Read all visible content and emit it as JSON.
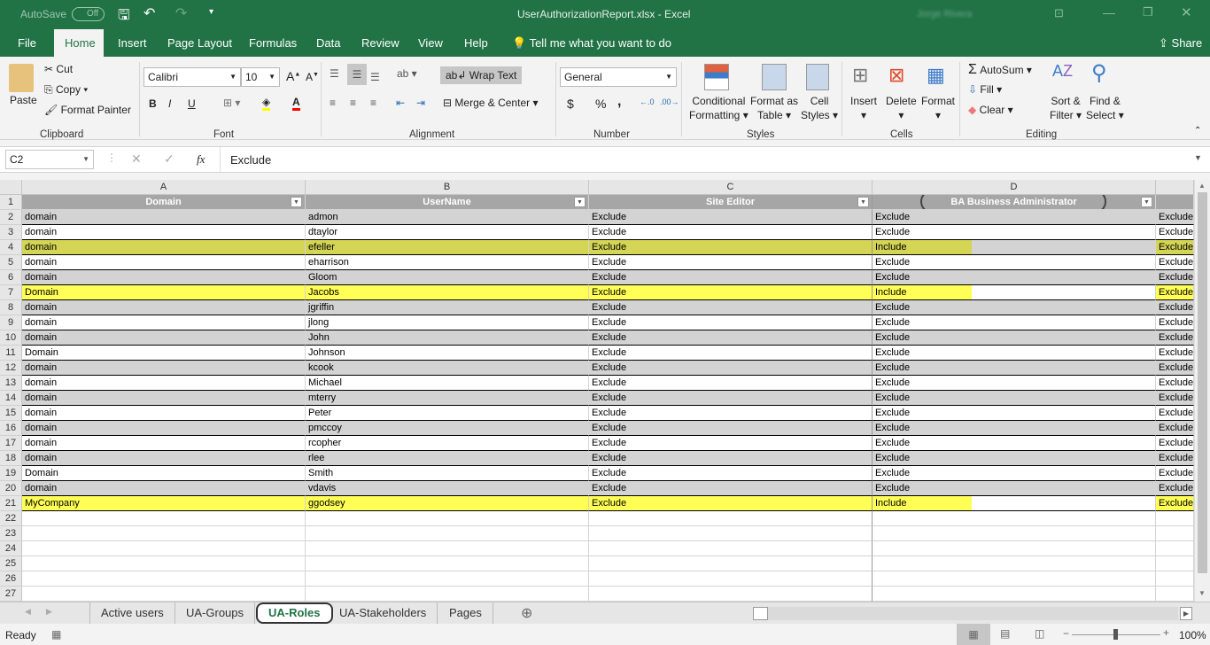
{
  "titlebar": {
    "autosave": "AutoSave",
    "autosave_state": "Off",
    "title": "UserAuthorizationReport.xlsx  -  Excel",
    "user": "Jorge Rivera"
  },
  "ribbon_tabs": [
    "File",
    "Home",
    "Insert",
    "Page Layout",
    "Formulas",
    "Data",
    "Review",
    "View",
    "Help"
  ],
  "active_tab": "Home",
  "tell_me": "Tell me what you want to do",
  "share": "Share",
  "clipboard": {
    "paste": "Paste",
    "cut": "Cut",
    "copy": "Copy",
    "format_painter": "Format Painter",
    "label": "Clipboard"
  },
  "font": {
    "name": "Calibri",
    "size": "10",
    "bold": "B",
    "italic": "I",
    "underline": "U",
    "label": "Font",
    "fill_color": "#ffff00",
    "font_color": "#ff0000"
  },
  "alignment": {
    "wrap": "Wrap Text",
    "merge": "Merge & Center",
    "label": "Alignment"
  },
  "number": {
    "format": "General",
    "currency": "$",
    "percent": "%",
    "comma": ",",
    "label": "Number"
  },
  "styles": {
    "conditional": "Conditional",
    "conditional2": "Formatting",
    "format_table": "Format as",
    "format_table2": "Table",
    "cell_styles": "Cell",
    "cell_styles2": "Styles",
    "label": "Styles"
  },
  "cells": {
    "insert": "Insert",
    "delete": "Delete",
    "format": "Format",
    "label": "Cells"
  },
  "editing": {
    "autosum": "AutoSum",
    "fill": "Fill",
    "clear": "Clear",
    "sort": "Sort &",
    "sort2": "Filter",
    "find": "Find &",
    "find2": "Select",
    "label": "Editing"
  },
  "formula_bar": {
    "name_box": "C2",
    "fx": "fx",
    "value": "Exclude"
  },
  "columns": [
    "A",
    "B",
    "C",
    "D"
  ],
  "headers": [
    "Domain",
    "UserName",
    "Site Editor",
    "BA Business Administrator"
  ],
  "col_e_value": "Exclude",
  "rows": [
    [
      "domain",
      "admon",
      "Exclude",
      "Exclude"
    ],
    [
      "domain",
      "dtaylor",
      "Exclude",
      "Exclude"
    ],
    [
      "domain",
      "efeller",
      "Exclude",
      "Include"
    ],
    [
      "domain",
      "eharrison",
      "Exclude",
      "Exclude"
    ],
    [
      "domain",
      "Gloom",
      "Exclude",
      "Exclude"
    ],
    [
      "Domain",
      "Jacobs",
      "Exclude",
      "Include"
    ],
    [
      "domain",
      "jgriffin",
      "Exclude",
      "Exclude"
    ],
    [
      "domain",
      "jlong",
      "Exclude",
      "Exclude"
    ],
    [
      "domain",
      "John",
      "Exclude",
      "Exclude"
    ],
    [
      "Domain",
      "Johnson",
      "Exclude",
      "Exclude"
    ],
    [
      "domain",
      "kcook",
      "Exclude",
      "Exclude"
    ],
    [
      "domain",
      "Michael",
      "Exclude",
      "Exclude"
    ],
    [
      "domain",
      "mterry",
      "Exclude",
      "Exclude"
    ],
    [
      "domain",
      "Peter",
      "Exclude",
      "Exclude"
    ],
    [
      "domain",
      "pmccoy",
      "Exclude",
      "Exclude"
    ],
    [
      "domain",
      "rcopher",
      "Exclude",
      "Exclude"
    ],
    [
      "domain",
      "rlee",
      "Exclude",
      "Exclude"
    ],
    [
      "Domain",
      "Smith",
      "Exclude",
      "Exclude"
    ],
    [
      "domain",
      "vdavis",
      "Exclude",
      "Exclude"
    ],
    [
      "MyCompany",
      "ggodsey",
      "Exclude",
      "Include"
    ]
  ],
  "row_numbers": [
    "1",
    "2",
    "3",
    "4",
    "5",
    "6",
    "7",
    "8",
    "9",
    "10",
    "11",
    "12",
    "13",
    "14",
    "15",
    "16",
    "17",
    "18",
    "19",
    "20",
    "21",
    "22",
    "23",
    "24",
    "25",
    "26",
    "27"
  ],
  "highlight": {
    "row4": "#d4d455",
    "row7": "#ffff55",
    "row21": "#ffff55",
    "band": "#d3d3d3"
  },
  "sheets": [
    "Active users",
    "UA-Groups",
    "UA-Roles",
    "UA-Stakeholders",
    "Pages"
  ],
  "active_sheet": "UA-Roles",
  "status": {
    "ready": "Ready",
    "zoom": "100%"
  },
  "accent": "#217346"
}
